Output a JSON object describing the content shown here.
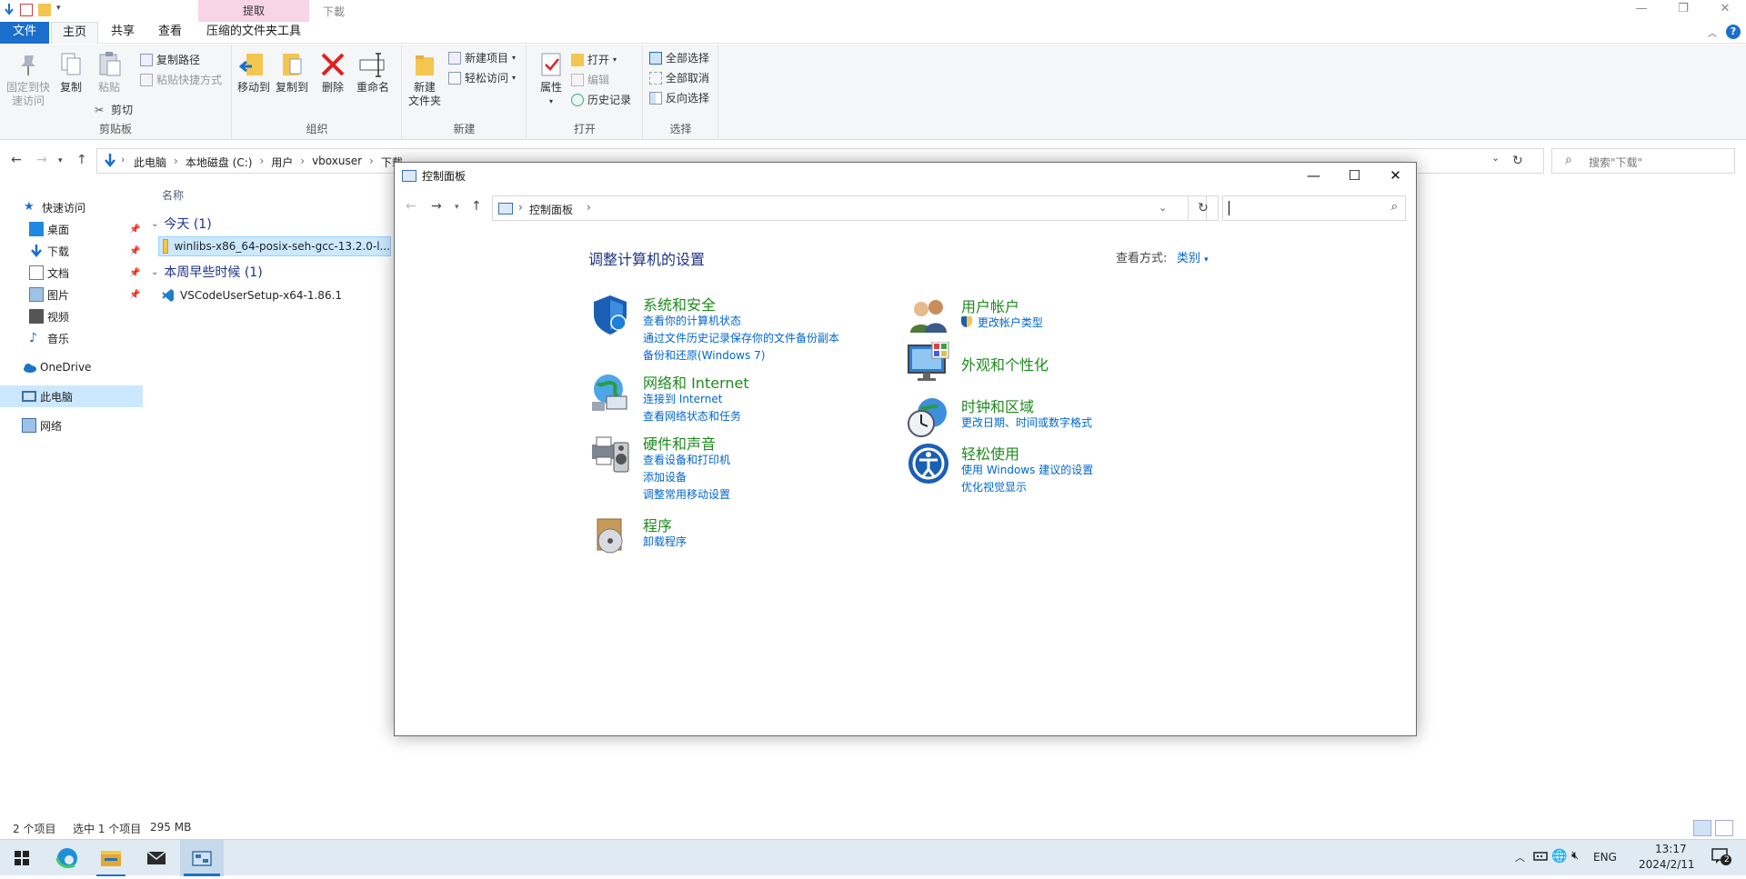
{
  "explorer": {
    "title": "下載",
    "context_tab_group": "提取",
    "tabs": {
      "file": "文件",
      "home": "主页",
      "share": "共享",
      "view": "查看",
      "tools": "压缩的文件夹工具"
    },
    "ribbon": {
      "clipboard": {
        "label": "剪贴板",
        "pin": "固定到快\n速访问",
        "pin_l1": "固定到快",
        "pin_l2": "速访问",
        "copy": "复制",
        "paste": "粘贴",
        "copy_path": "复制路径",
        "paste_shortcut": "粘贴快捷方式",
        "cut": "剪切"
      },
      "organize": {
        "label": "组织",
        "move_to": "移动到",
        "copy_to": "复制到",
        "delete": "删除",
        "rename": "重命名"
      },
      "new": {
        "label": "新建",
        "new_folder_l1": "新建",
        "new_folder_l2": "文件夹",
        "new_item": "新建项目",
        "easy_access": "轻松访问"
      },
      "open": {
        "label": "打开",
        "properties": "属性",
        "open": "打开",
        "edit": "编辑",
        "history": "历史记录"
      },
      "select": {
        "label": "选择",
        "select_all": "全部选择",
        "select_none": "全部取消",
        "invert": "反向选择"
      }
    },
    "address": {
      "crumbs": [
        "此电脑",
        "本地磁盘 (C:)",
        "用户",
        "vboxuser",
        "下载"
      ],
      "search_placeholder": "搜索\"下载\""
    },
    "nav": {
      "quick_access": "快速访问",
      "desktop": "桌面",
      "downloads": "下载",
      "documents": "文档",
      "pictures": "图片",
      "videos": "视频",
      "music": "音乐",
      "onedrive": "OneDrive",
      "this_pc": "此电脑",
      "network": "网络"
    },
    "files": {
      "column_name": "名称",
      "group_today": "今天 (1)",
      "group_earlier": "本周早些时候 (1)",
      "file1": "winlibs-x86_64-posix-seh-gcc-13.2.0-l...",
      "file2": "VSCodeUserSetup-x64-1.86.1"
    },
    "status": {
      "count": "2 个项目",
      "selected": "选中 1 个项目",
      "size": "295 MB"
    }
  },
  "control_panel": {
    "title": "控制面板",
    "crumb": "控制面板",
    "heading": "调整计算机的设置",
    "view_by_label": "查看方式:",
    "view_by_value": "类别",
    "categories": {
      "system": {
        "title": "系统和安全",
        "links": [
          "查看你的计算机状态",
          "通过文件历史记录保存你的文件备份副本",
          "备份和还原(Windows 7)"
        ]
      },
      "network": {
        "title": "网络和 Internet",
        "links": [
          "连接到 Internet",
          "查看网络状态和任务"
        ]
      },
      "hardware": {
        "title": "硬件和声音",
        "links": [
          "查看设备和打印机",
          "添加设备",
          "调整常用移动设置"
        ]
      },
      "programs": {
        "title": "程序",
        "links": [
          "卸载程序"
        ]
      },
      "accounts": {
        "title": "用户帐户",
        "links": [
          "更改帐户类型"
        ]
      },
      "appearance": {
        "title": "外观和个性化",
        "links": []
      },
      "clock": {
        "title": "时钟和区域",
        "links": [
          "更改日期、时间或数字格式"
        ]
      },
      "ease": {
        "title": "轻松使用",
        "links": [
          "使用 Windows 建议的设置",
          "优化视觉显示"
        ]
      }
    }
  },
  "taskbar": {
    "language": "ENG",
    "time": "13:17",
    "date": "2024/2/11",
    "notification_count": "2"
  },
  "colors": {
    "accent": "#1a6ecc",
    "link": "#0066cc",
    "category_title": "#1f8a1f",
    "heading": "#1e3287",
    "taskbar": "#dfeaf3"
  }
}
